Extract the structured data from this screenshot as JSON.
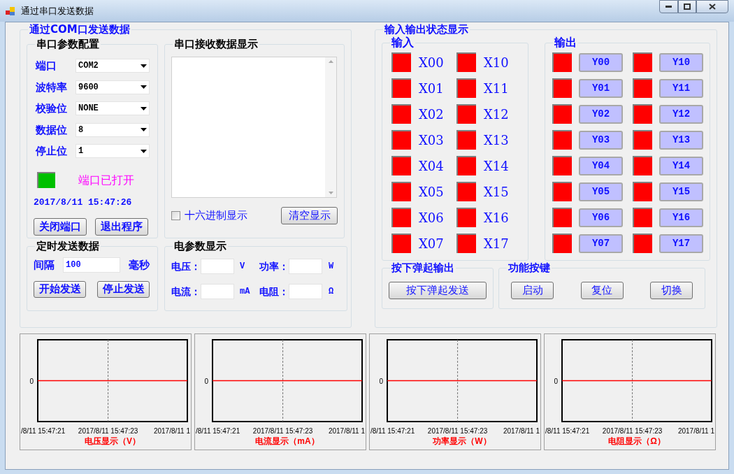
{
  "window": {
    "title": "通过串口发送数据"
  },
  "send_group": {
    "title": "通过COM口发送数据",
    "serial_config": {
      "title": "串口参数配置",
      "fields": [
        {
          "label": "端口",
          "value": "COM2"
        },
        {
          "label": "波特率",
          "value": "9600"
        },
        {
          "label": "校验位",
          "value": "NONE"
        },
        {
          "label": "数据位",
          "value": "8"
        },
        {
          "label": "停止位",
          "value": "1"
        }
      ],
      "port_status": {
        "open": true,
        "text": "端口已打开"
      },
      "timestamp": "2017/8/11 15:47:26",
      "buttons": [
        "关闭端口",
        "退出程序"
      ]
    },
    "receive": {
      "title": "串口接收数据显示",
      "hex_display": {
        "label": "十六进制显示",
        "checked": false
      },
      "clear_button": "清空显示"
    },
    "timed_send": {
      "title": "定时发送数据",
      "interval_label": "间隔",
      "interval_value": "100",
      "unit": "毫秒",
      "buttons": [
        "开始发送",
        "停止发送"
      ]
    },
    "electrical": {
      "title": "电参数显示",
      "fields": [
        {
          "label": "电压：",
          "unit": "V"
        },
        {
          "label": "功率：",
          "unit": "W"
        },
        {
          "label": "电流：",
          "unit": "mA"
        },
        {
          "label": "电阻：",
          "unit": "Ω"
        }
      ]
    }
  },
  "io_group": {
    "title": "输入输出状态显示",
    "inputs": {
      "title": "输入",
      "items": [
        {
          "label": "X00",
          "on": false
        },
        {
          "label": "X01",
          "on": false
        },
        {
          "label": "X02",
          "on": false
        },
        {
          "label": "X03",
          "on": false
        },
        {
          "label": "X04",
          "on": false
        },
        {
          "label": "X05",
          "on": false
        },
        {
          "label": "X06",
          "on": false
        },
        {
          "label": "X07",
          "on": false
        },
        {
          "label": "X10",
          "on": false
        },
        {
          "label": "X11",
          "on": false
        },
        {
          "label": "X12",
          "on": false
        },
        {
          "label": "X13",
          "on": false
        },
        {
          "label": "X14",
          "on": false
        },
        {
          "label": "X15",
          "on": false
        },
        {
          "label": "X16",
          "on": false
        },
        {
          "label": "X17",
          "on": false
        }
      ]
    },
    "outputs": {
      "title": "输出",
      "items": [
        {
          "label": "Y00",
          "on": false
        },
        {
          "label": "Y01",
          "on": false
        },
        {
          "label": "Y02",
          "on": false
        },
        {
          "label": "Y03",
          "on": false
        },
        {
          "label": "Y04",
          "on": false
        },
        {
          "label": "Y05",
          "on": false
        },
        {
          "label": "Y06",
          "on": false
        },
        {
          "label": "Y07",
          "on": false
        },
        {
          "label": "Y10",
          "on": false
        },
        {
          "label": "Y11",
          "on": false
        },
        {
          "label": "Y12",
          "on": false
        },
        {
          "label": "Y13",
          "on": false
        },
        {
          "label": "Y14",
          "on": false
        },
        {
          "label": "Y15",
          "on": false
        },
        {
          "label": "Y16",
          "on": false
        },
        {
          "label": "Y17",
          "on": false
        }
      ]
    },
    "push_output": {
      "title": "按下弹起输出",
      "button": "按下弹起发送"
    },
    "functions": {
      "title": "功能按键",
      "buttons": [
        "启动",
        "复位",
        "切换"
      ]
    }
  },
  "charts": [
    {
      "title": "电压显示（V）",
      "y_label": "0",
      "x_labels": [
        "/8/11 15:47:21",
        "2017/8/11 15:47:23",
        "2017/8/11 1"
      ]
    },
    {
      "title": "电流显示（mA）",
      "y_label": "0",
      "x_labels": [
        "/8/11 15:47:21",
        "2017/8/11 15:47:23",
        "2017/8/11 1"
      ]
    },
    {
      "title": "功率显示（W）",
      "y_label": "0",
      "x_labels": [
        "/8/11 15:47:21",
        "2017/8/11 15:47:23",
        "2017/8/11 1"
      ]
    },
    {
      "title": "电阻显示（Ω）",
      "y_label": "0",
      "x_labels": [
        "/8/11 15:47:21",
        "2017/8/11 15:47:23",
        "2017/8/11 1"
      ]
    }
  ]
}
